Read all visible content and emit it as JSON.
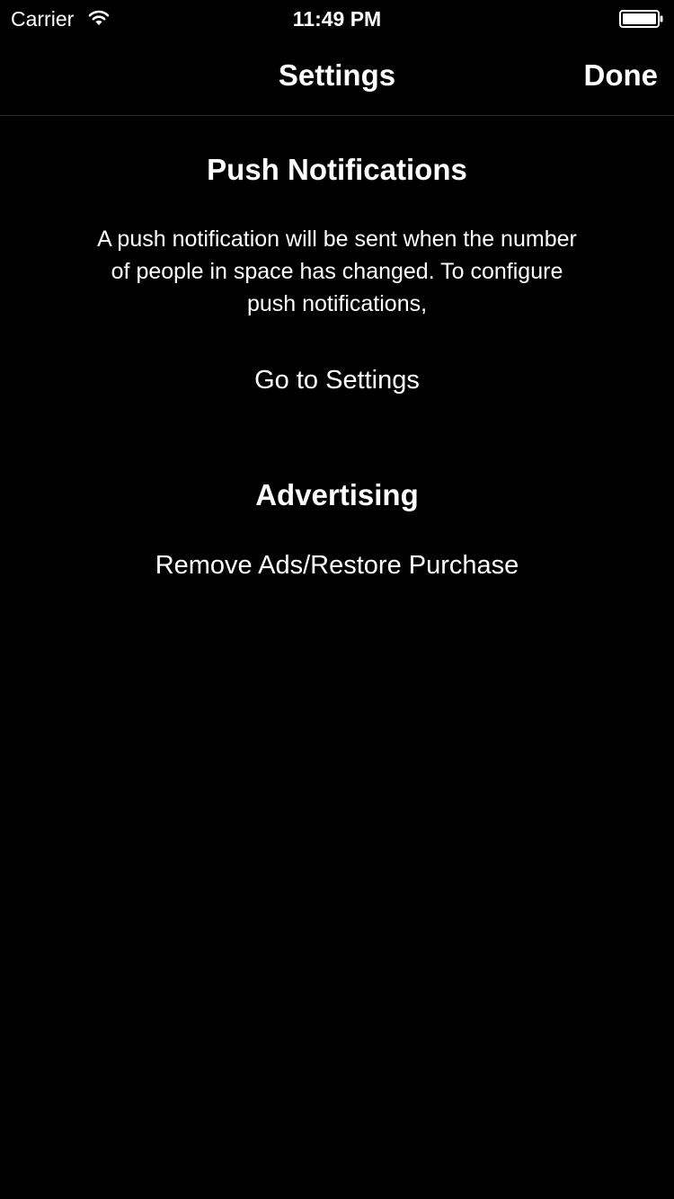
{
  "status_bar": {
    "carrier": "Carrier",
    "time": "11:49 PM",
    "wifi_icon": "wifi-icon",
    "battery_icon": "battery-icon"
  },
  "nav_bar": {
    "title": "Settings",
    "done_label": "Done"
  },
  "push_section": {
    "title": "Push Notifications",
    "description": "A push notification will be sent when the number of people in space has changed. To configure push notifications,",
    "link_label": "Go to Settings"
  },
  "ads_section": {
    "title": "Advertising",
    "link_label": "Remove Ads/Restore Purchase"
  },
  "colors": {
    "background": "#000000",
    "text": "#ffffff",
    "separator": "#2a2a2a"
  }
}
